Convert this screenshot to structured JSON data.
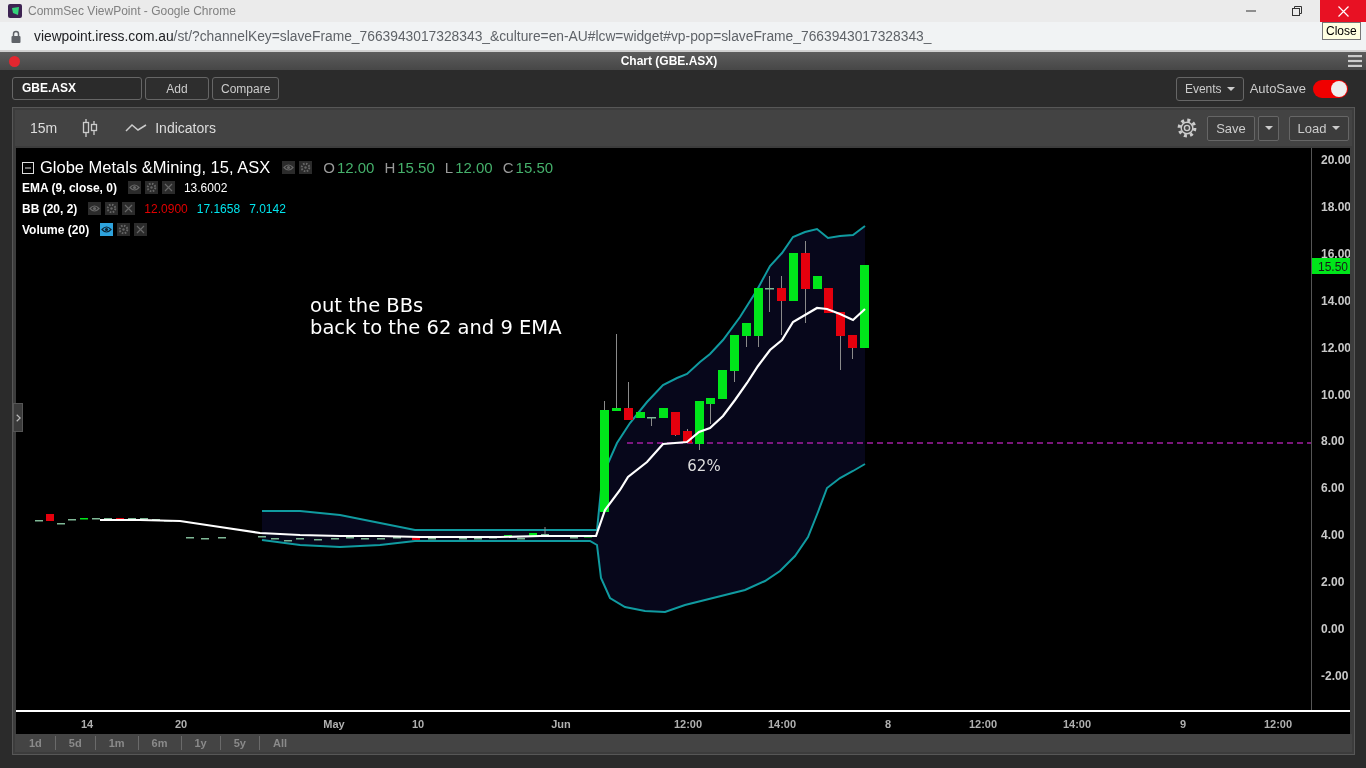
{
  "browser": {
    "title": "CommSec ViewPoint - Google Chrome",
    "url_host": "viewpoint.iress.com.au",
    "url_path": "/st/?channelKey=slaveFrame_7663943017328343_&culture=en-AU#lcw=widget#vp-pop=slaveFrame_7663943017328343_",
    "tooltip": "Close"
  },
  "window": {
    "title": "Chart (GBE.ASX)"
  },
  "toolbar": {
    "symbol": "GBE.ASX",
    "buttons": [
      "Add",
      "Compare"
    ],
    "events": "Events",
    "autosave": {
      "label": "AutoSave",
      "on": true
    }
  },
  "chart_toolbar": {
    "interval": "15m",
    "indicators": "Indicators",
    "save": "Save",
    "load": "Load"
  },
  "legend": {
    "title": "Globe Metals &Mining, 15, ASX",
    "ohlc": [
      {
        "label": "O",
        "value": "12.00"
      },
      {
        "label": "H",
        "value": "15.50"
      },
      {
        "label": "L",
        "value": "12.00"
      },
      {
        "label": "C",
        "value": "15.50"
      }
    ],
    "indicators": [
      {
        "label": "EMA (9, close, 0)",
        "eye_on": false,
        "values": [
          {
            "text": "13.6002",
            "color": "#ffffff"
          }
        ]
      },
      {
        "label": "BB (20, 2)",
        "eye_on": false,
        "values": [
          {
            "text": "12.0900",
            "color": "#e00000"
          },
          {
            "text": "17.1658",
            "color": "#00e5ee"
          },
          {
            "text": "7.0142",
            "color": "#00e5ee"
          }
        ]
      },
      {
        "label": "Volume (20)",
        "eye_on": true
      }
    ]
  },
  "chart": {
    "annotation": [
      "out the BBs",
      "back to the 62 and 9 EMA"
    ],
    "level_label": "62%",
    "last_price": "15.50",
    "y_axis": [
      "20.00",
      "18.00",
      "16.00",
      "14.00",
      "12.00",
      "10.00",
      "8.00",
      "6.00",
      "4.00",
      "2.00",
      "0.00",
      "-2.00"
    ],
    "x_axis": [
      "14",
      "20",
      "May",
      "10",
      "Jun",
      "12:00",
      "14:00",
      "8",
      "12:00",
      "14:00",
      "9",
      "12:00"
    ]
  },
  "ranges": [
    {
      "label": "1d",
      "selected": false
    },
    {
      "label": "5d",
      "selected": false
    },
    {
      "label": "1m",
      "selected": false
    },
    {
      "label": "6m",
      "selected": false
    },
    {
      "label": "1y",
      "selected": false
    },
    {
      "label": "5y",
      "selected": false
    },
    {
      "label": "All",
      "selected": false
    }
  ]
}
